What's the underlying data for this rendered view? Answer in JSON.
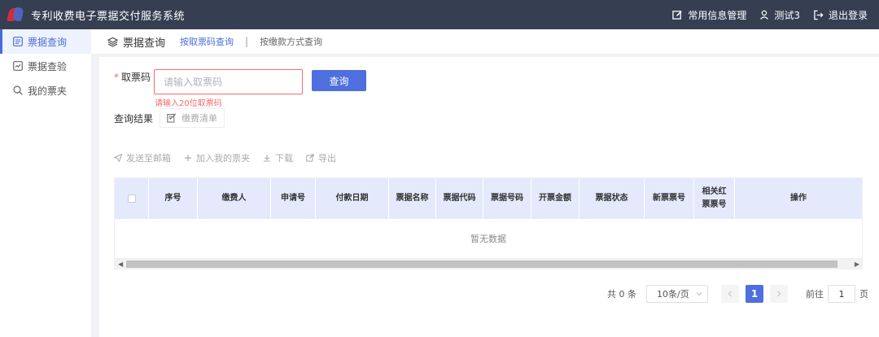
{
  "header": {
    "title": "专利收费电子票据交付服务系统",
    "items": [
      {
        "label": "常用信息管理",
        "icon": "edit-icon"
      },
      {
        "label": "测试3",
        "icon": "user-icon"
      },
      {
        "label": "退出登录",
        "icon": "logout-icon"
      }
    ]
  },
  "sidebar": {
    "items": [
      {
        "label": "票据查询",
        "icon": "doc-list-icon",
        "active": true
      },
      {
        "label": "票据查验",
        "icon": "check-chart-icon"
      },
      {
        "label": "我的票夹",
        "icon": "search-icon"
      }
    ]
  },
  "tabs": {
    "main_label": "票据查询",
    "items": [
      {
        "label": "按取票码查询",
        "active": true
      },
      {
        "label": "按缴款方式查询"
      }
    ],
    "separator": "|"
  },
  "form": {
    "required_mark": "*",
    "label": "取票码",
    "placeholder": "请输入取票码",
    "value": "",
    "search_label": "查询",
    "error": "请输入20位取票码"
  },
  "result": {
    "label": "查询结果",
    "fee_button": "缴费清单"
  },
  "actions": [
    {
      "label": "发送至邮箱",
      "icon": "send-icon"
    },
    {
      "label": "加入我的票夹",
      "icon": "plus-icon"
    },
    {
      "label": "下载",
      "icon": "download-icon"
    },
    {
      "label": "导出",
      "icon": "export-icon"
    }
  ],
  "table": {
    "headers": [
      "序号",
      "缴费人",
      "申请号",
      "付款日期",
      "票据名称",
      "票据代码",
      "票据号码",
      "开票金额",
      "票据状态",
      "新票票号",
      "相关红票票号",
      "操作"
    ],
    "empty_text": "暂无数据"
  },
  "pagination": {
    "total": "共 0 条",
    "page_size": "10条/页",
    "current_page": "1",
    "goto_label": "前往",
    "goto_value": "1",
    "page_suffix": "页"
  }
}
